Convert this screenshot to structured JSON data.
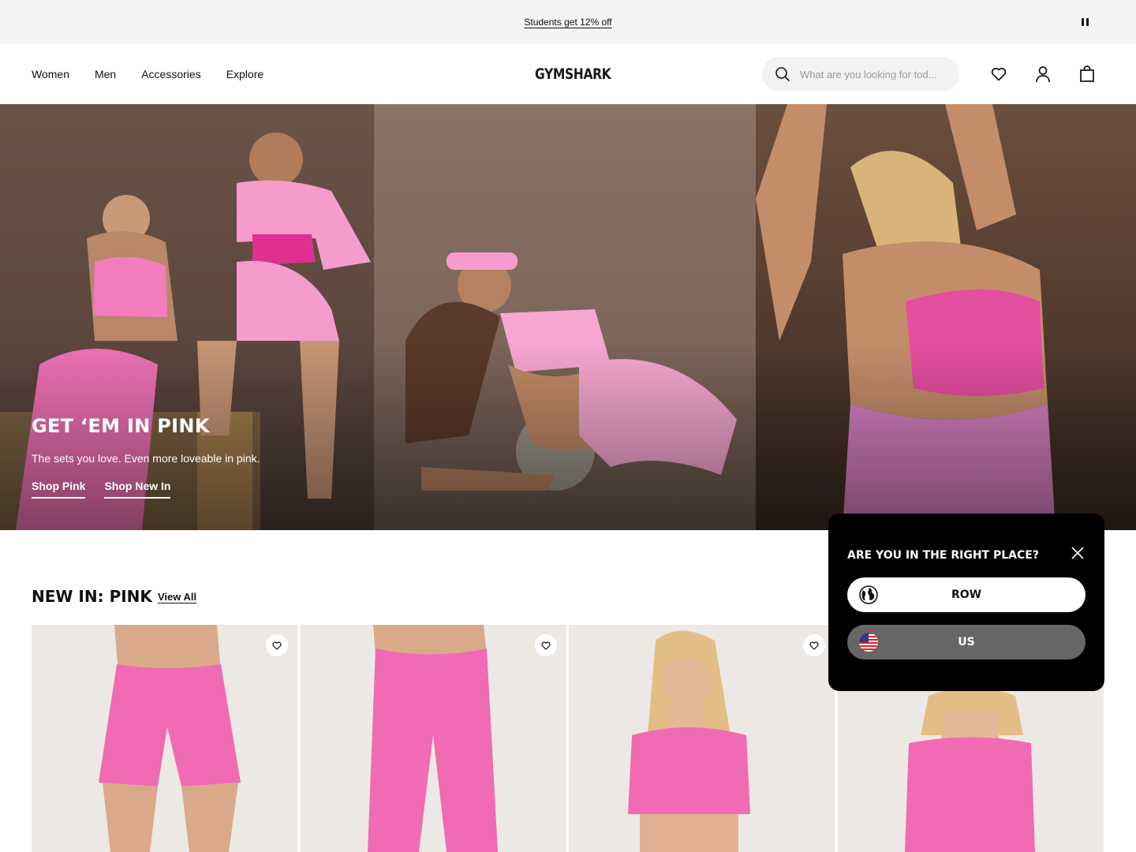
{
  "promo": {
    "text": "Students get 12% off",
    "pause_icon": "pause-icon"
  },
  "nav": {
    "items": [
      "Women",
      "Men",
      "Accessories",
      "Explore"
    ]
  },
  "brand": {
    "logo": "GYMSHARK"
  },
  "search": {
    "placeholder": "What are you looking for tod..."
  },
  "header_icons": [
    "heart-icon",
    "user-icon",
    "bag-icon"
  ],
  "hero": {
    "title": "GET ‘EM IN PINK",
    "subtitle": "The sets you love. Even more loveable in pink.",
    "links": [
      "Shop Pink",
      "Shop New In"
    ]
  },
  "section": {
    "title": "NEW IN: PINK",
    "view_all": "View All"
  },
  "products": [
    {
      "icon": "heart-icon"
    },
    {
      "icon": "heart-icon"
    },
    {
      "icon": "heart-icon"
    },
    {
      "icon": "heart-icon"
    }
  ],
  "region_modal": {
    "title": "ARE YOU IN THE RIGHT PLACE?",
    "options": [
      {
        "label": "ROW",
        "icon": "globe-icon"
      },
      {
        "label": "US",
        "icon": "us-flag-icon"
      }
    ]
  },
  "colors": {
    "pink": "#f06bb4",
    "modal_bg": "#000000",
    "us_button": "#666666",
    "promo_bg": "#f4f4f4"
  }
}
